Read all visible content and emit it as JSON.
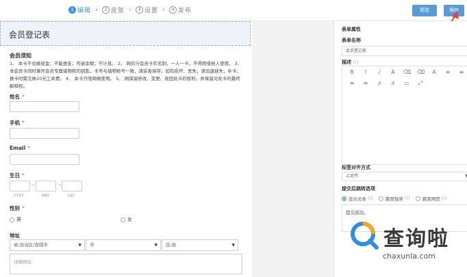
{
  "steps": [
    {
      "num": "1",
      "label": "编辑"
    },
    {
      "num": "2",
      "label": "皮肤"
    },
    {
      "num": "3",
      "label": "设置"
    },
    {
      "num": "4",
      "label": "发布"
    }
  ],
  "toolbar": {
    "preview_label": "预览",
    "save_label": "保存"
  },
  "form": {
    "title": "会员登记表",
    "notice_title": "会员须知",
    "notice_body": "1、 本卡不兑换现金；不能透支；可退余额；不计息。 2、 网实行会员卡实名制，一人一卡，不得转借他人使用。 3、 本会员卡同时兼开会员专属储物柜的钥匙，卡号与储物柜号一致，请妥善保存。如有损坏、丢失，请迅速挂失，补卡、换卡时需交纳10元工本费。 4、 本卡只限网络使用。 5、 网保留修改、变更、收回此卡的权利，并保留对此卡的最终解释权。",
    "required_mark": "*",
    "fields": {
      "name": "姓名",
      "phone": "手机",
      "email": "Email",
      "birthday": "生日",
      "gender": "性别",
      "address": "地址"
    },
    "date_sep": "-",
    "date_caps": {
      "yyyy": "YYYY",
      "mm": "MM",
      "dd": "DD"
    },
    "gender_options": {
      "male": "男",
      "female": "女"
    },
    "address_selects": {
      "province": "省/自治区/直辖市",
      "city": "市",
      "district": "区/县"
    },
    "address_detail_placeholder": "详细地址"
  },
  "panel": {
    "heading": "表单属性",
    "name_label": "表单名称",
    "name_value": "会员登记表",
    "desc_label": "描述",
    "desc_hint": "(?)",
    "editor_row1": [
      "B",
      "I",
      "⁄",
      "A",
      "⌫",
      "⌫",
      "A",
      "≡",
      "≡"
    ],
    "editor_row2": [
      "≡",
      "≡",
      "∂",
      "∂",
      "▭",
      "⤢"
    ],
    "align_label": "标签对齐方式",
    "align_value": "上对齐",
    "submit_label": "提交后跳转选项",
    "submit_options": [
      {
        "label": "显示文本",
        "hint": "(?)"
      },
      {
        "label": "跳至独奖",
        "hint": "(?)"
      },
      {
        "label": "跳至网页",
        "hint": "(?)"
      }
    ],
    "submit_text": "提交成功。"
  },
  "watermark": {
    "cn": "查询啦",
    "url": "chaxunla.com"
  },
  "colors": {
    "accent": "#4a90e2",
    "button": "#5b9bd5",
    "arrow": "#e0453a"
  }
}
